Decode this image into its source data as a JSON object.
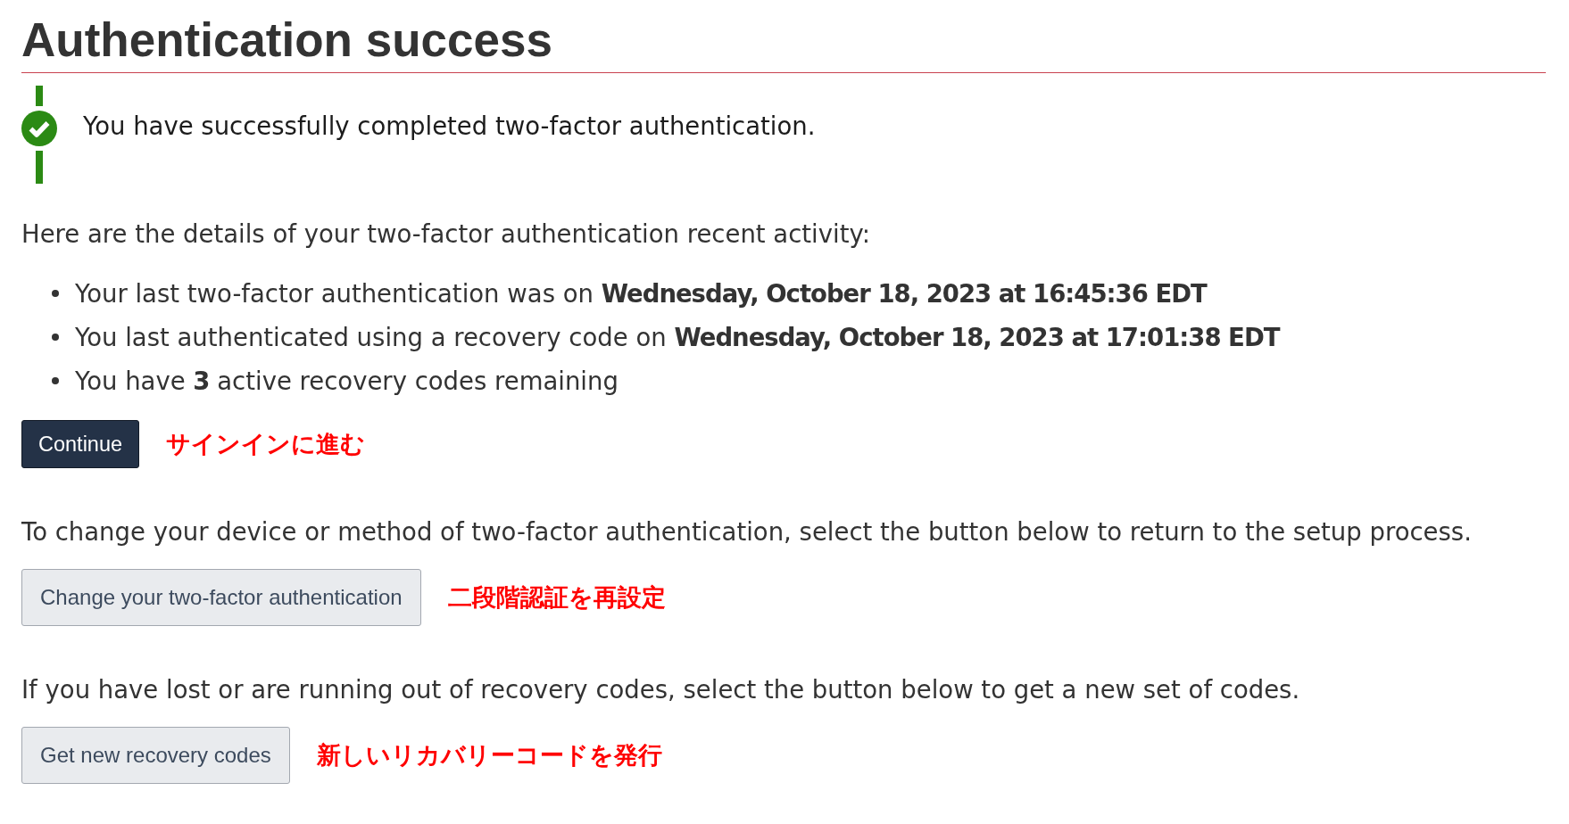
{
  "page": {
    "title": "Authentication success"
  },
  "alert": {
    "kind": "success",
    "message": "You have successfully completed two-factor authentication."
  },
  "details": {
    "intro": "Here are the details of your two-factor authentication recent activity:",
    "items": [
      "Your last two-factor authentication was on **Wednesday, October 18, 2023 at 16:45:36 EDT**",
      "You last authenticated using a recovery code on **Wednesday, October 18, 2023 at 17:01:38 EDT**",
      "You have **3** active recovery codes remaining"
    ]
  },
  "actions": [
    {
      "button": {
        "label": "Continue",
        "kind": "primary"
      },
      "annotation": "サインインに進む"
    },
    {
      "text": "To change your device or method of two-factor authentication, select the button below to return to the setup process.",
      "button": {
        "label": "Change your two-factor authentication",
        "kind": "secondary"
      },
      "annotation": "二段階認証を再設定"
    },
    {
      "text": "If you have lost or are running out of recovery codes, select the button below to get a new set of codes.",
      "button": {
        "label": "Get new recovery codes",
        "kind": "secondary"
      },
      "annotation": "新しいリカバリーコードを発行"
    }
  ]
}
